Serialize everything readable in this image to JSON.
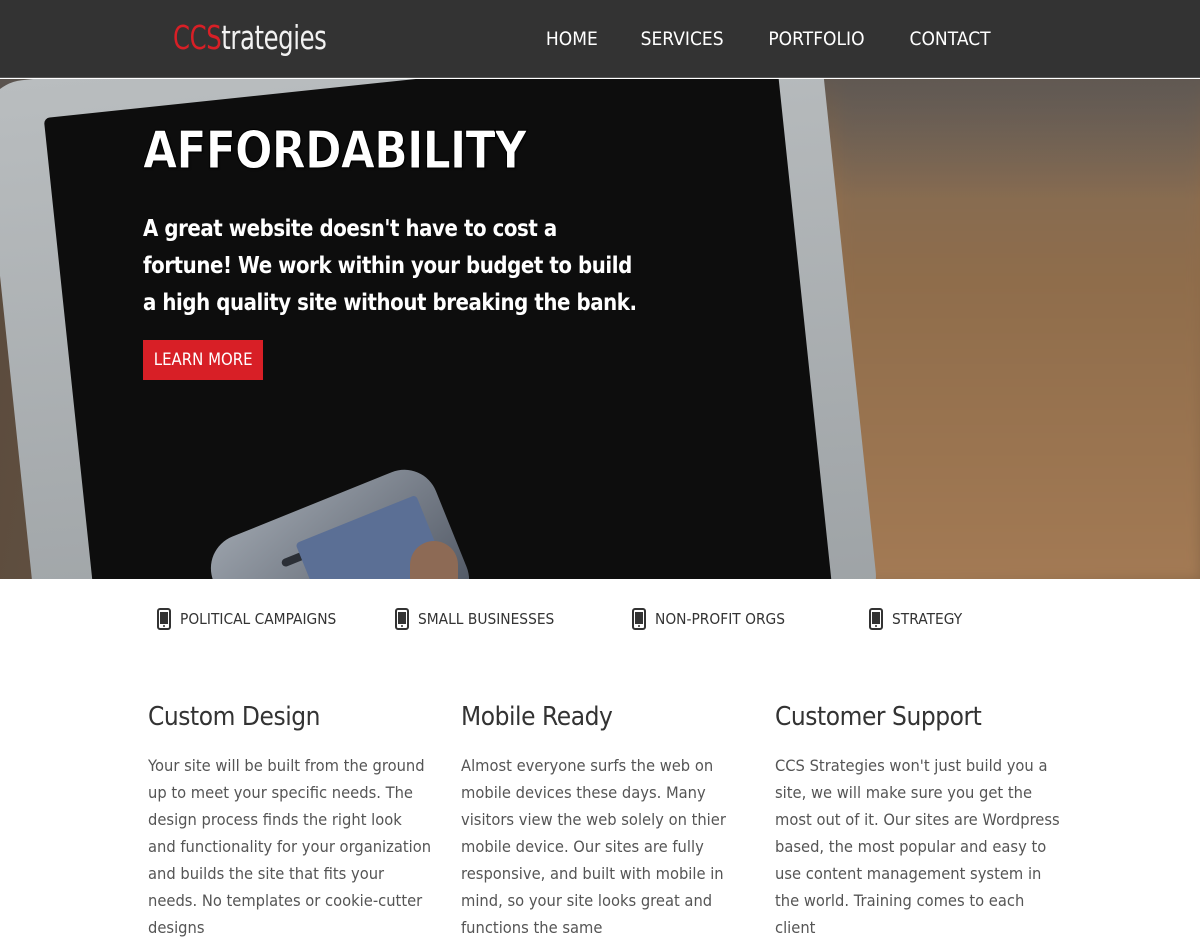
{
  "header": {
    "logo_red": "CCS",
    "logo_white": "trategies",
    "nav": [
      {
        "label": "HOME"
      },
      {
        "label": "SERVICES"
      },
      {
        "label": "PORTFOLIO"
      },
      {
        "label": "CONTACT"
      }
    ]
  },
  "hero": {
    "title": "AFFORDABILITY",
    "text": "A great website doesn't have to cost a fortune! We work within your budget to build a high quality site without breaking the bank.",
    "button_label": "LEARN MORE"
  },
  "categories": [
    {
      "label": "POLITICAL CAMPAIGNS",
      "icon": "mobile-phone-icon"
    },
    {
      "label": "SMALL BUSINESSES",
      "icon": "mobile-phone-icon"
    },
    {
      "label": "NON-PROFIT ORGS",
      "icon": "mobile-phone-icon"
    },
    {
      "label": "STRATEGY",
      "icon": "mobile-phone-icon"
    }
  ],
  "features": [
    {
      "title": "Custom Design",
      "text": "Your site will be built from the ground up to meet your specific needs. The design process finds the right look and functionality for your organization and builds the site that fits your needs. No templates or cookie-cutter designs"
    },
    {
      "title": "Mobile Ready",
      "text": "Almost everyone surfs the web on mobile devices these days. Many visitors view the web solely on thier mobile device. Our sites are fully responsive, and built with mobile in mind, so your site looks great and functions the same"
    },
    {
      "title": "Customer Support",
      "text": "CCS Strategies won't just build you a site, we will make sure you get the most out of it. Our sites are Wordpress based, the most popular and easy to use content management system in the world. Training comes to each client"
    }
  ],
  "colors": {
    "accent": "#d81f26",
    "header_bg": "#333333"
  }
}
